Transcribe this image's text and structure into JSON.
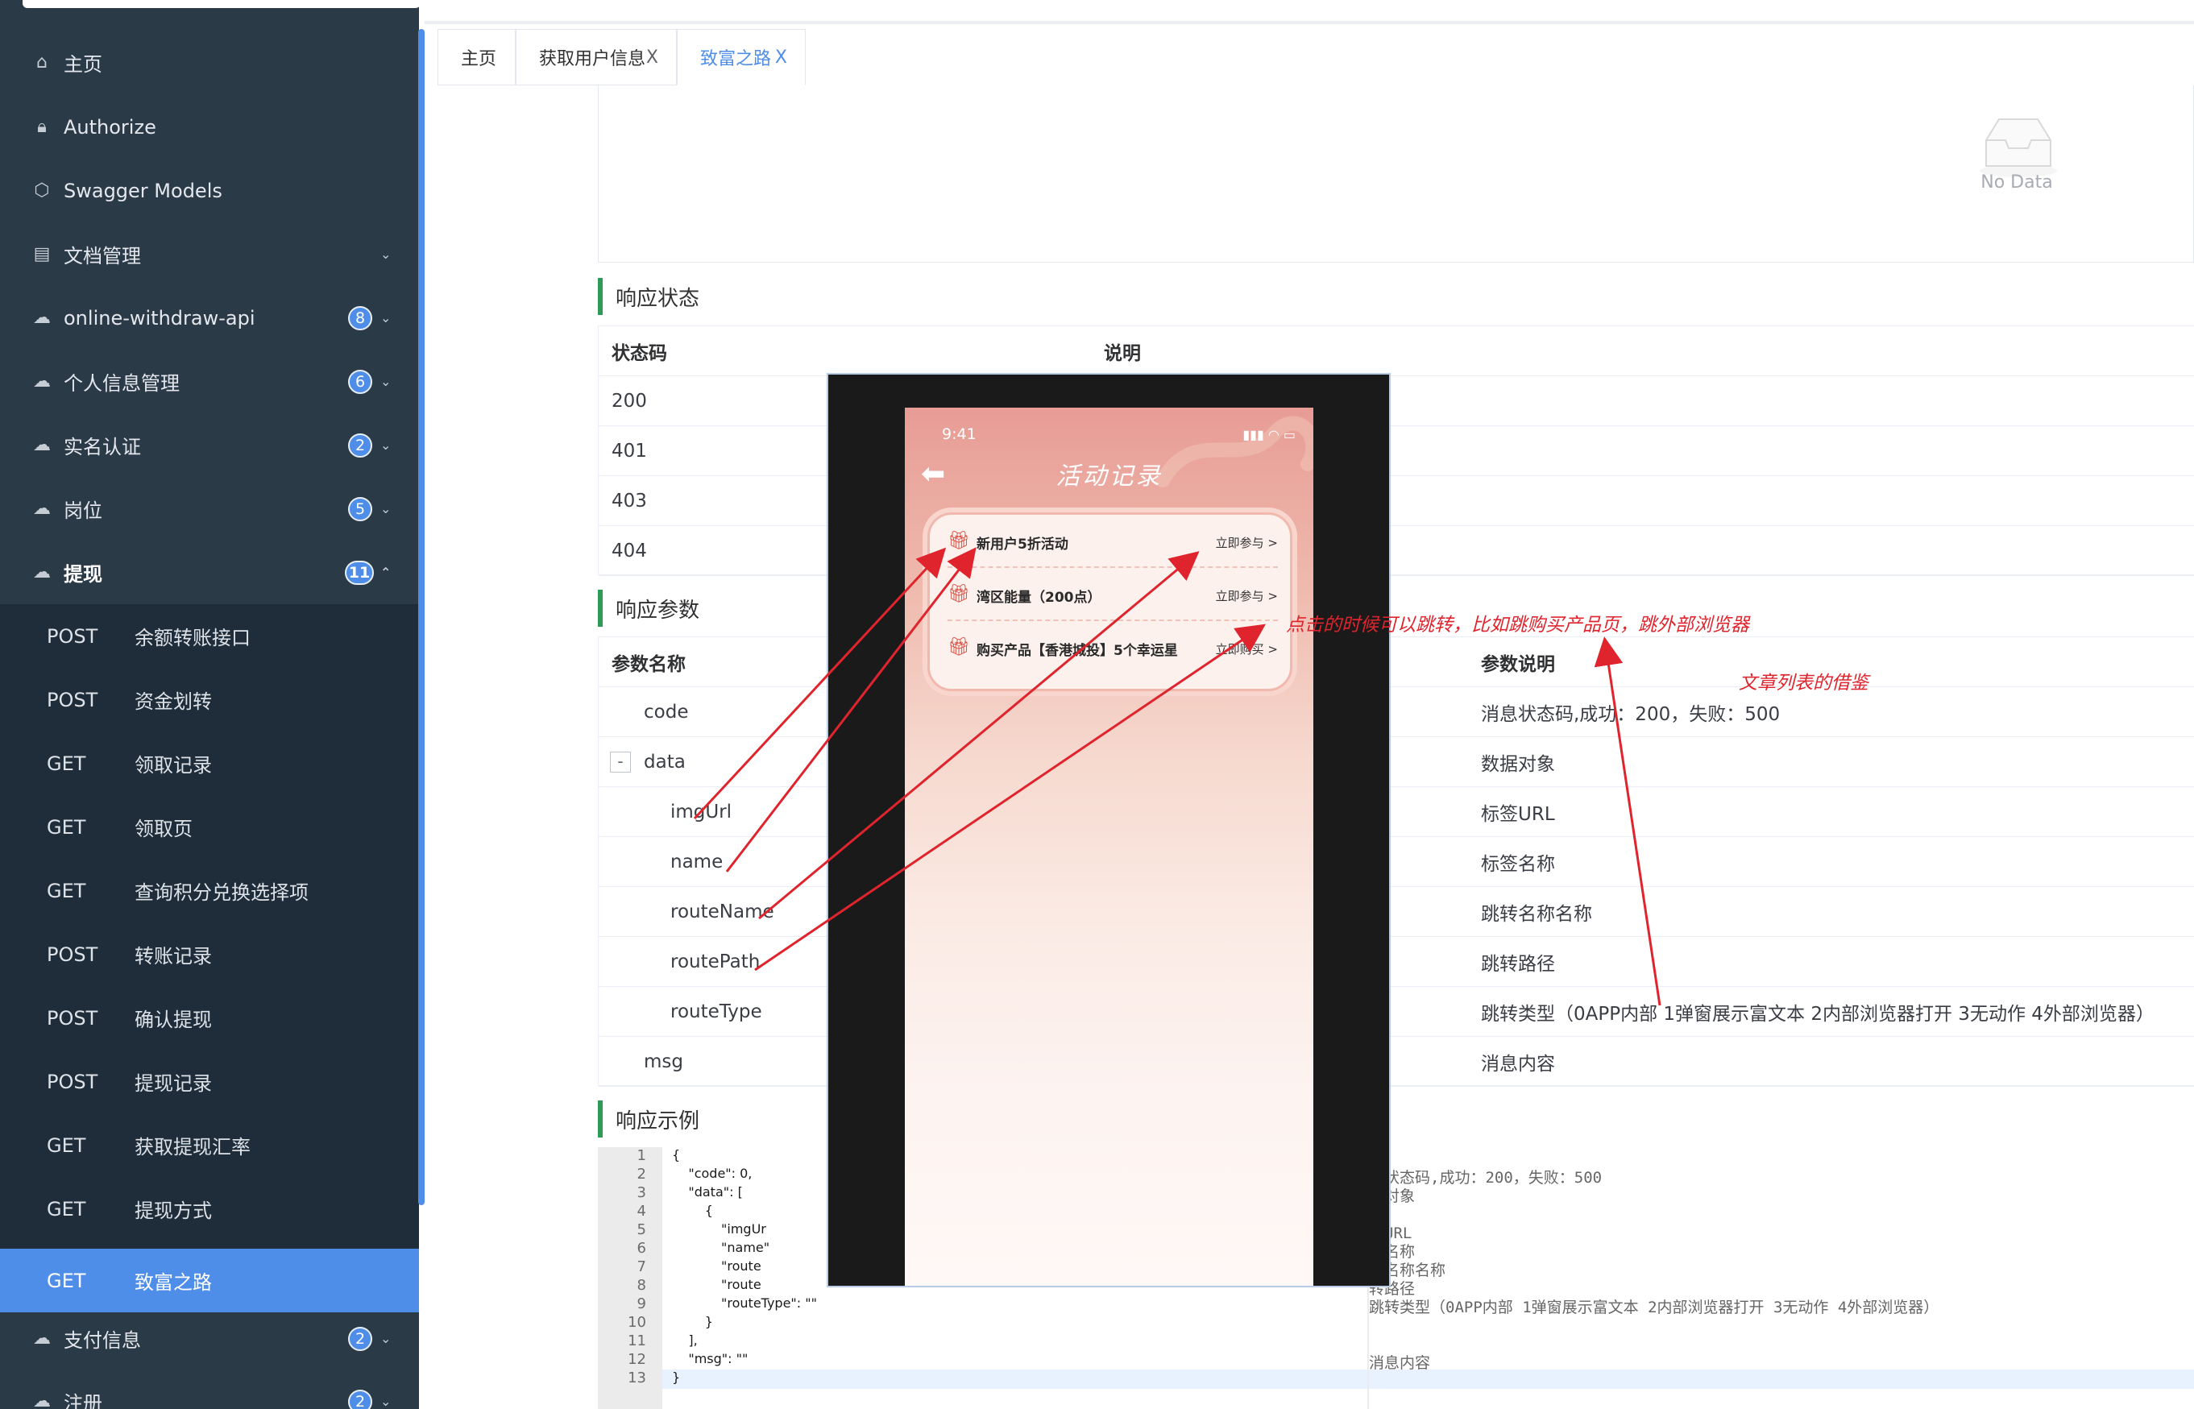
{
  "sidebar": {
    "items": [
      {
        "label": "主页",
        "icon": "home-icon"
      },
      {
        "label": "Authorize",
        "icon": "lock-icon"
      },
      {
        "label": "Swagger Models",
        "icon": "cube-icon"
      },
      {
        "label": "文档管理",
        "icon": "document-icon"
      },
      {
        "label": "online-withdraw-api",
        "icon": "cloud-icon",
        "badge": "8"
      },
      {
        "label": "个人信息管理",
        "icon": "cloud-icon",
        "badge": "6"
      },
      {
        "label": "实名认证",
        "icon": "cloud-icon",
        "badge": "2"
      },
      {
        "label": "岗位",
        "icon": "cloud-icon",
        "badge": "5"
      },
      {
        "label": "提现",
        "icon": "cloud-icon",
        "badge": "11"
      },
      {
        "label": "支付信息",
        "icon": "cloud-icon",
        "badge": "2"
      },
      {
        "label": "注册",
        "icon": "cloud-icon",
        "badge": "2"
      }
    ],
    "sub_items": [
      {
        "method": "POST",
        "name": "余额转账接口"
      },
      {
        "method": "POST",
        "name": "资金划转"
      },
      {
        "method": "GET",
        "name": "领取记录"
      },
      {
        "method": "GET",
        "name": "领取页"
      },
      {
        "method": "GET",
        "name": "查询积分兑换选择项"
      },
      {
        "method": "POST",
        "name": "转账记录"
      },
      {
        "method": "POST",
        "name": "确认提现"
      },
      {
        "method": "POST",
        "name": "提现记录"
      },
      {
        "method": "GET",
        "name": "获取提现汇率"
      },
      {
        "method": "GET",
        "name": "提现方式"
      },
      {
        "method": "GET",
        "name": "致富之路"
      }
    ],
    "accent": "#4f8ee8"
  },
  "tabs": [
    {
      "label": "主页"
    },
    {
      "label": "获取用户信息",
      "close": "X"
    },
    {
      "label": "致富之路",
      "close": "X"
    }
  ],
  "no_data": "No Data",
  "response_status": {
    "title": "响应状态",
    "headers": [
      "状态码",
      "说明"
    ],
    "rows": [
      "200",
      "401",
      "403",
      "404"
    ]
  },
  "response_params": {
    "title": "响应参数",
    "headers": [
      "参数名称",
      "参数说明"
    ],
    "rows": [
      {
        "name": "code",
        "desc": "消息状态码,成功：200，失败：500"
      },
      {
        "name": "data",
        "desc": "数据对象",
        "toggle": "-"
      },
      {
        "name": "imgUrl",
        "desc": "标签URL"
      },
      {
        "name": "name",
        "desc": "标签名称"
      },
      {
        "name": "routeName",
        "desc": "跳转名称名称"
      },
      {
        "name": "routePath",
        "desc": "跳转路径"
      },
      {
        "name": "routeType",
        "desc": "跳转类型（0APP内部 1弹窗展示富文本 2内部浏览器打开 3无动作 4外部浏览器）"
      },
      {
        "name": "msg",
        "desc": "消息内容"
      }
    ]
  },
  "response_example": {
    "title": "响应示例",
    "line_numbers": [
      "1",
      "2",
      "3",
      "4",
      "5",
      "6",
      "7",
      "8",
      "9",
      "10",
      "11",
      "12",
      "13"
    ],
    "lines": [
      "{",
      "    \"code\": 0,",
      "    \"data\": [",
      "        {",
      "            \"imgUr",
      "            \"name\"",
      "            \"route",
      "            \"route",
      "            \"routeType\": \"\"",
      "        }",
      "    ],",
      "    \"msg\": \"\"",
      "}"
    ],
    "comments": [
      "息状态码,成功：200，失败：500",
      "据对象",
      "签URL",
      "签名称",
      "转名称名称",
      "转路径",
      "跳转类型（0APP内部 1弹窗展示富文本 2内部浏览器打开 3无动作 4外部浏览器）",
      "消息内容"
    ]
  },
  "phone": {
    "time": "9:41",
    "title": "活动记录",
    "activities": [
      {
        "name": "新用户5折活动",
        "action": "立即参与 >"
      },
      {
        "name": "湾区能量（200点）",
        "action": "立即参与 >"
      },
      {
        "name": "购买产品【香港城投】5个幸运星",
        "action": "立即购买 >"
      }
    ]
  },
  "annotations": {
    "jump_note": "点击的时候可以跳转，比如跳购买产品页，跳外部浏览器",
    "list_note": "文章列表的借鉴",
    "color": "#e0242d"
  }
}
